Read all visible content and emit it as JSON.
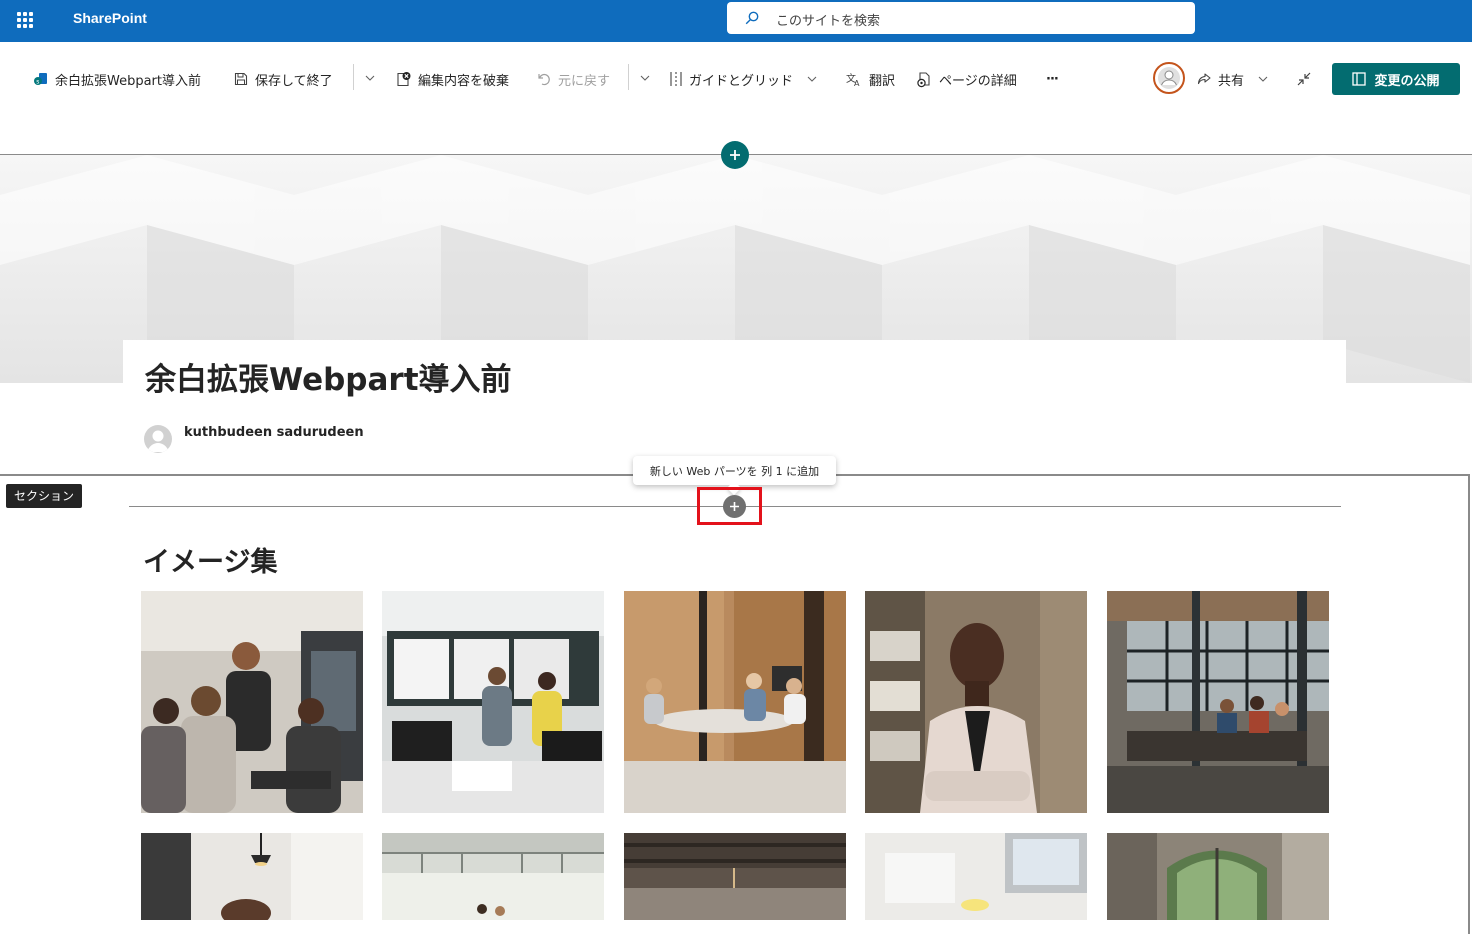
{
  "suite_bar": {
    "app_name": "SharePoint",
    "search_placeholder": "このサイトを検索",
    "brand_color": "#0f6cbd"
  },
  "command_bar": {
    "page_name": "余白拡張Webpart導入前",
    "save_and_close": "保存して終了",
    "discard_edits": "編集内容を破棄",
    "undo": "元に戻す",
    "guides_and_grid": "ガイドとグリッド",
    "translate": "翻訳",
    "page_details": "ページの詳細",
    "more": "···",
    "share": "共有",
    "publish": "変更の公開",
    "publish_color": "#036c70"
  },
  "page": {
    "title": "余白拡張Webpart導入前",
    "author": "kuthbudeen sadurudeen"
  },
  "section": {
    "badge": "セクション",
    "tooltip": "新しい Web パーツを 列 1 に追加"
  },
  "gallery": {
    "title": "イメージ集",
    "images": [
      {
        "icon": "photo-team-at-computer"
      },
      {
        "icon": "photo-office-whiteboard"
      },
      {
        "icon": "photo-meeting-room"
      },
      {
        "icon": "photo-woman-portrait"
      },
      {
        "icon": "photo-open-office-meeting"
      },
      {
        "icon": "photo-man-with-lamps"
      },
      {
        "icon": "photo-people-in-atrium"
      },
      {
        "icon": "photo-industrial-office"
      },
      {
        "icon": "photo-desk-laptop"
      },
      {
        "icon": "photo-office-windows"
      }
    ]
  }
}
